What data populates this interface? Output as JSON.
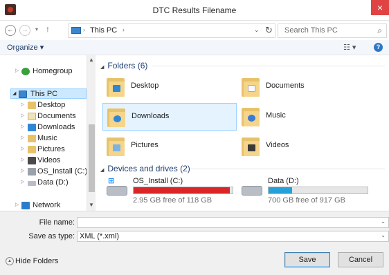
{
  "window": {
    "title": "DTC Results Filename",
    "close": "×"
  },
  "address": {
    "back": "←",
    "forward": "→",
    "drop": "▾",
    "up": "↑",
    "separator": "›",
    "crumb": "This PC",
    "dropdown": "⌄",
    "refresh": "↻",
    "search_placeholder": "Search This PC",
    "search_icon": "⌕"
  },
  "command_bar": {
    "organize": "Organize ▾",
    "view": "☷ ▾",
    "help": "?"
  },
  "nav_pane": {
    "items": [
      {
        "label": "Homegroup",
        "icon": "homegroup-icon",
        "chevron": "▷"
      },
      {
        "label": "This PC",
        "icon": "pc-icon",
        "chevron": "◢"
      },
      {
        "label": "Desktop",
        "icon": "desktop-folder-icon",
        "chevron": "▷"
      },
      {
        "label": "Documents",
        "icon": "documents-folder-icon",
        "chevron": "▷"
      },
      {
        "label": "Downloads",
        "icon": "downloads-folder-icon",
        "chevron": "▷"
      },
      {
        "label": "Music",
        "icon": "music-folder-icon",
        "chevron": "▷"
      },
      {
        "label": "Pictures",
        "icon": "pictures-folder-icon",
        "chevron": "▷"
      },
      {
        "label": "Videos",
        "icon": "videos-folder-icon",
        "chevron": "▷"
      },
      {
        "label": "OS_Install (C:)",
        "icon": "system-drive-icon",
        "chevron": "▷"
      },
      {
        "label": "Data (D:)",
        "icon": "drive-icon",
        "chevron": "▷"
      },
      {
        "label": "Network",
        "icon": "network-icon",
        "chevron": "▷"
      }
    ],
    "scroll_up": "▲",
    "scroll_down": "▼"
  },
  "content": {
    "folders_header": "Folders (6)",
    "folders": [
      {
        "label": "Desktop",
        "icon": "desktop-folder-icon"
      },
      {
        "label": "Documents",
        "icon": "documents-folder-icon"
      },
      {
        "label": "Downloads",
        "icon": "downloads-folder-icon"
      },
      {
        "label": "Music",
        "icon": "music-folder-icon"
      },
      {
        "label": "Pictures",
        "icon": "pictures-folder-icon"
      },
      {
        "label": "Videos",
        "icon": "videos-folder-icon"
      }
    ],
    "drives_header": "Devices and drives (2)",
    "drives": [
      {
        "label": "OS_Install (C:)",
        "free": "2.95 GB free of 118 GB",
        "used_fraction": 0.975,
        "bar_color": "#da2626"
      },
      {
        "label": "Data (D:)",
        "free": "700 GB free of 917 GB",
        "used_fraction": 0.24,
        "bar_color": "#26a0da"
      }
    ]
  },
  "form": {
    "filename_label": "File name:",
    "filename_value": "",
    "type_label": "Save as type:",
    "type_value": "XML (*.xml)",
    "dropdown": "⌄"
  },
  "footer": {
    "hide_folders": "Hide Folders",
    "hide_icon": "▲",
    "save": "Save",
    "cancel": "Cancel"
  }
}
